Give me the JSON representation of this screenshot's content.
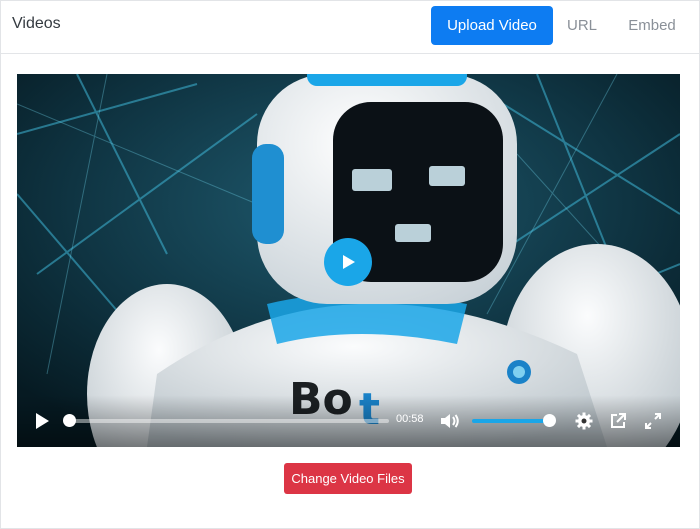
{
  "header": {
    "title": "Videos",
    "tabs": {
      "upload": "Upload Video",
      "url": "URL",
      "embed": "Embed"
    }
  },
  "player": {
    "current_time": "00:58",
    "progress_fraction": 0.02,
    "volume_fraction": 0.9,
    "accent_color": "#1aa6e8"
  },
  "actions": {
    "change_files": "Change Video Files"
  }
}
